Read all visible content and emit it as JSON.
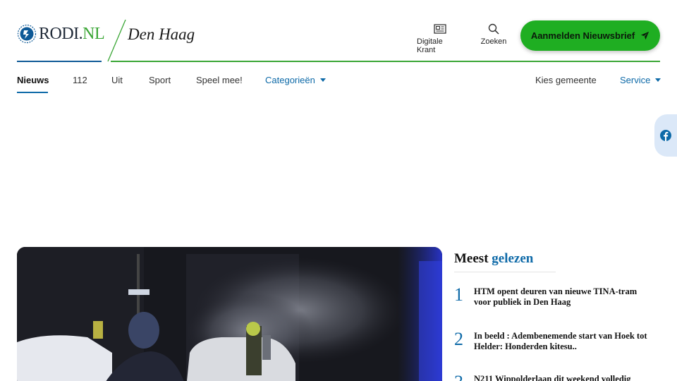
{
  "site": {
    "logo_text": "RODI.",
    "logo_tld": "NL",
    "city": "Den Haag"
  },
  "tools": {
    "digitale_krant": "Digitale Krant",
    "zoeken": "Zoeken"
  },
  "cta": {
    "label": "Aanmelden Nieuwsbrief"
  },
  "nav": {
    "items": [
      {
        "label": "Nieuws"
      },
      {
        "label": "112"
      },
      {
        "label": "Uit"
      },
      {
        "label": "Sport"
      },
      {
        "label": "Speel mee!"
      },
      {
        "label": "Categorieën"
      },
      {
        "label": "Kies gemeente"
      },
      {
        "label": "Service"
      }
    ]
  },
  "meest_gelezen": {
    "title_a": "Meest ",
    "title_b": "gelezen",
    "items": [
      {
        "num": "1",
        "text": "HTM opent deuren van nieuwe TINA-tram voor publiek in Den Haag"
      },
      {
        "num": "2",
        "text": "In beeld : Adembenemende start van Hoek tot Helder: Honderden kitesu.."
      },
      {
        "num": "3",
        "text": "N211 Wippolderlaan dit weekend volledig"
      }
    ]
  },
  "colors": {
    "brand_green": "#3aa635",
    "cta_green": "#1fae22",
    "brand_blue": "#0e6aa8"
  },
  "icons": [
    "newspaper-icon",
    "search-icon",
    "paper-plane-icon",
    "facebook-icon",
    "caret-down-icon"
  ]
}
